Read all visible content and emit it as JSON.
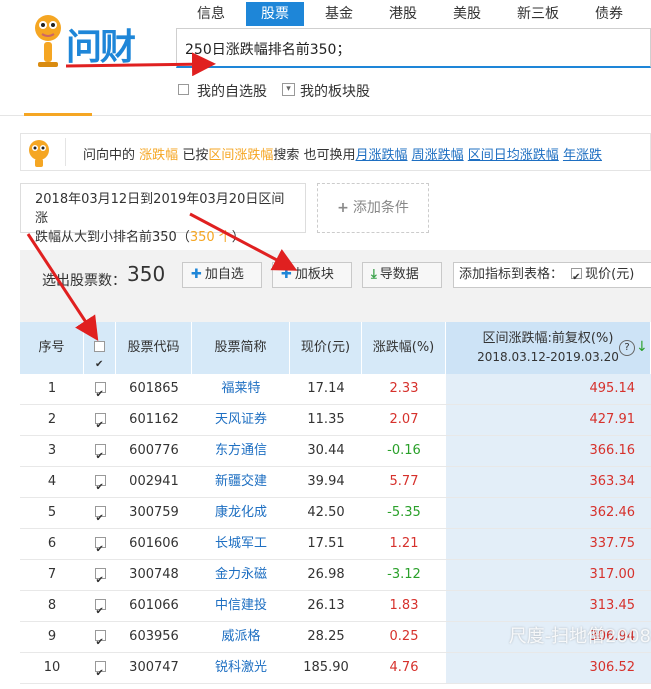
{
  "header": {
    "logo_text": "问财",
    "nav": [
      "信息",
      "股票",
      "基金",
      "港股",
      "美股",
      "新三板",
      "债券"
    ],
    "nav_active": 1,
    "search_value": "250日涨跌幅排名前350；",
    "options": [
      {
        "label": "我的自选股",
        "checked": false
      },
      {
        "label": "我的板块股",
        "checked": false
      }
    ]
  },
  "info_bar": {
    "p1": "问向中的",
    "term": "涨跌幅",
    "p2": "已按",
    "term2": "区间涨跌幅",
    "p3": "搜索  也可换用",
    "links": [
      "月涨跌幅",
      "周涨跌幅",
      "区间日均涨跌幅",
      "年涨跌"
    ]
  },
  "condition": {
    "line1": "2018年03月12日到2019年03月20日区间涨",
    "line2": "跌幅从大到小排名前350（",
    "count": "350 个",
    "close": "）",
    "add_label": "添加条件"
  },
  "toolbar": {
    "selected_label": "选出股票数：",
    "selected_count": "350",
    "btn_add_watch": "加自选",
    "btn_add_block": "加板块",
    "btn_export": "导数据",
    "addcol_label": "添加指标到表格：",
    "addcol_opt": "现价(元)"
  },
  "table": {
    "headers": {
      "seq": "序号",
      "code": "股票代码",
      "name": "股票简称",
      "price": "现价(元)",
      "change": "涨跌幅(%)",
      "range_line1": "区间涨跌幅:前复权(%)",
      "range_line2": "2018.03.12-2019.03.20"
    },
    "rows": [
      {
        "seq": "1",
        "code": "601865",
        "name": "福莱特",
        "price": "17.14",
        "change": "2.33",
        "range": "495.14"
      },
      {
        "seq": "2",
        "code": "601162",
        "name": "天风证券",
        "price": "11.35",
        "change": "2.07",
        "range": "427.91"
      },
      {
        "seq": "3",
        "code": "600776",
        "name": "东方通信",
        "price": "30.44",
        "change": "-0.16",
        "range": "366.16"
      },
      {
        "seq": "4",
        "code": "002941",
        "name": "新疆交建",
        "price": "39.94",
        "change": "5.77",
        "range": "363.34"
      },
      {
        "seq": "5",
        "code": "300759",
        "name": "康龙化成",
        "price": "42.50",
        "change": "-5.35",
        "range": "362.46"
      },
      {
        "seq": "6",
        "code": "601606",
        "name": "长城军工",
        "price": "17.51",
        "change": "1.21",
        "range": "337.75"
      },
      {
        "seq": "7",
        "code": "300748",
        "name": "金力永磁",
        "price": "26.98",
        "change": "-3.12",
        "range": "317.00"
      },
      {
        "seq": "8",
        "code": "601066",
        "name": "中信建投",
        "price": "26.13",
        "change": "1.83",
        "range": "313.45"
      },
      {
        "seq": "9",
        "code": "603956",
        "name": "威派格",
        "price": "28.25",
        "change": "0.25",
        "range": "306.94"
      },
      {
        "seq": "10",
        "code": "300747",
        "name": "锐科激光",
        "price": "185.90",
        "change": "4.76",
        "range": "306.52"
      }
    ]
  },
  "watermark": "尺度-扫地僧2008",
  "colors": {
    "brand": "#1e86d8",
    "accent": "#f5a623",
    "up": "#d6312c",
    "down": "#2aa02a",
    "header_bg": "#d6e9f8",
    "highlight_col": "#e3eef8"
  }
}
